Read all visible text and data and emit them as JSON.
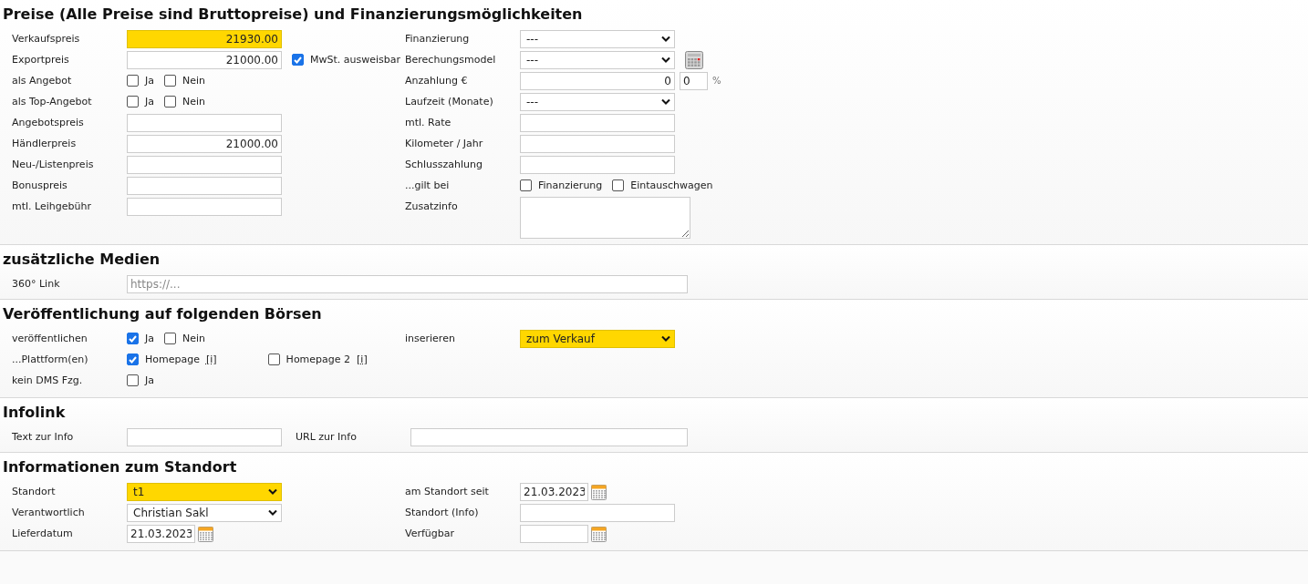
{
  "sections": [
    {
      "title": "Preise (Alle Preise sind Bruttopreise) und Finanzierungsmöglichkeiten",
      "kind": "columns",
      "left": [
        {
          "label": "Verkaufspreis",
          "controls": [
            {
              "kind": "amount",
              "value": "21930.00",
              "highlighted": true
            }
          ]
        },
        {
          "label": "Exportpreis",
          "controls": [
            {
              "kind": "amount",
              "value": "21000.00",
              "highlighted": false
            },
            {
              "kind": "check",
              "label": "MwSt. ausweisbar",
              "checked": true
            }
          ]
        },
        {
          "label": "als Angebot",
          "controls": [
            {
              "kind": "check",
              "label": "Ja",
              "checked": false
            },
            {
              "kind": "check",
              "label": "Nein",
              "checked": false
            }
          ]
        },
        {
          "label": "als Top-Angebot",
          "controls": [
            {
              "kind": "check",
              "label": "Ja",
              "checked": false
            },
            {
              "kind": "check",
              "label": "Nein",
              "checked": false
            }
          ]
        },
        {
          "label": "Angebotspreis",
          "controls": [
            {
              "kind": "amount",
              "highlighted": false
            }
          ]
        },
        {
          "label": "Händlerpreis",
          "controls": [
            {
              "kind": "amount",
              "value": "21000.00",
              "highlighted": false
            }
          ]
        },
        {
          "label": "Neu-/Listenpreis",
          "controls": [
            {
              "kind": "amount",
              "highlighted": false
            }
          ]
        },
        {
          "label": "Bonuspreis",
          "controls": [
            {
              "kind": "amount",
              "highlighted": false
            }
          ]
        },
        {
          "label": "mtl. Leihgebühr",
          "controls": [
            {
              "kind": "amount",
              "highlighted": false
            }
          ]
        }
      ],
      "right": [
        {
          "label": "Finanzierung",
          "controls": [
            {
              "kind": "select",
              "value": "---",
              "highlighted": false
            }
          ]
        },
        {
          "label": "Berechungsmodel",
          "controls": [
            {
              "kind": "select",
              "value": "---",
              "highlighted": false
            },
            {
              "kind": "calculator"
            }
          ]
        },
        {
          "label": "Anzahlung €",
          "controls": [
            {
              "kind": "amount",
              "value": "0",
              "highlighted": false
            },
            {
              "kind": "short",
              "value": "0",
              "highlighted": false
            },
            {
              "kind": "unit",
              "text": "%"
            }
          ]
        },
        {
          "label": "Laufzeit (Monate)",
          "controls": [
            {
              "kind": "select",
              "value": "---",
              "highlighted": false
            }
          ]
        },
        {
          "label": "mtl. Rate",
          "controls": [
            {
              "kind": "amount",
              "highlighted": false
            }
          ]
        },
        {
          "label": "Kilometer / Jahr",
          "controls": [
            {
              "kind": "amount",
              "highlighted": false
            }
          ]
        },
        {
          "label": "Schlusszahlung",
          "controls": [
            {
              "kind": "amount",
              "highlighted": false
            }
          ]
        },
        {
          "label": "...gilt bei",
          "controls": [
            {
              "kind": "check",
              "label": "Finanzierung",
              "checked": false
            },
            {
              "kind": "check",
              "label": "Eintauschwagen",
              "checked": false
            }
          ]
        },
        {
          "label": "Zusatzinfo",
          "controls": [
            {
              "kind": "textarea"
            }
          ]
        }
      ]
    },
    {
      "title": "zusätzliche Medien",
      "kind": "inline",
      "rows": [
        {
          "items": [
            {
              "kind": "label",
              "text": "360° Link"
            },
            {
              "kind": "text",
              "placeholder": "https://...",
              "highlighted": false
            }
          ]
        }
      ]
    },
    {
      "title": "Veröffentlichung auf folgenden Börsen",
      "kind": "columns",
      "left": [
        {
          "label": "veröffentlichen",
          "controls": [
            {
              "kind": "check",
              "label": "Ja",
              "checked": true
            },
            {
              "kind": "check",
              "label": "Nein",
              "checked": false
            }
          ]
        },
        {
          "label": "...Plattform(en)",
          "controls": [
            {
              "kind": "check",
              "label": "Homepage",
              "link": "[i]",
              "checked": true
            },
            {
              "kind": "check",
              "label": "Homepage 2",
              "link": "[i]",
              "checked": false
            }
          ]
        },
        {
          "label": "kein DMS Fzg.",
          "controls": [
            {
              "kind": "check",
              "label": "Ja",
              "checked": false
            }
          ]
        }
      ],
      "right": [
        {
          "label": "inserieren",
          "controls": [
            {
              "kind": "select",
              "value": "zum Verkauf",
              "highlighted": true
            }
          ]
        }
      ]
    },
    {
      "title": "Infolink",
      "kind": "inline",
      "rows": [
        {
          "items": [
            {
              "kind": "label",
              "text": "Text zur Info"
            },
            {
              "kind": "text",
              "highlighted": false
            },
            {
              "kind": "label",
              "text": "URL zur Info"
            },
            {
              "kind": "text",
              "highlighted": false
            }
          ]
        }
      ]
    },
    {
      "title": "Informationen zum Standort",
      "kind": "columns",
      "left": [
        {
          "label": "Standort",
          "controls": [
            {
              "kind": "select",
              "value": "t1",
              "highlighted": true
            }
          ]
        },
        {
          "label": "Verantwortlich",
          "controls": [
            {
              "kind": "select",
              "value": "Christian Sakl",
              "highlighted": false
            }
          ]
        },
        {
          "label": "Lieferdatum",
          "controls": [
            {
              "kind": "date",
              "value": "21.03.2023"
            }
          ]
        }
      ],
      "right": [
        {
          "label": "am Standort seit",
          "controls": [
            {
              "kind": "date",
              "value": "21.03.2023"
            }
          ]
        },
        {
          "label": "Standort (Info)",
          "controls": [
            {
              "kind": "text",
              "highlighted": false
            }
          ]
        },
        {
          "label": "Verfügbar",
          "controls": [
            {
              "kind": "date"
            }
          ]
        }
      ]
    }
  ]
}
